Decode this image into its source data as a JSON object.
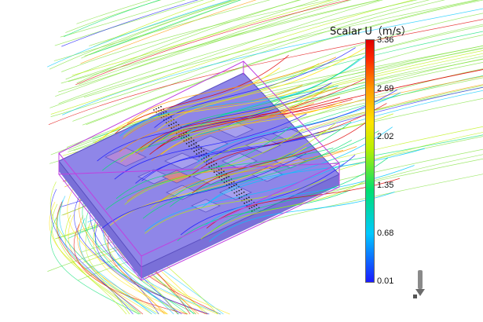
{
  "legend": {
    "title": "Scalar U（m/s）",
    "ticks": [
      "3.36",
      "2.69",
      "2.02",
      "1.35",
      "0.68",
      "0.01"
    ],
    "colors": [
      "#e00000",
      "#ff9a00",
      "#ffe400",
      "#b8f000",
      "#00e070",
      "#00c8ff",
      "#1a1aff"
    ]
  },
  "viewport": {
    "box_color": "#c040e0",
    "board_color": "#8f86e8",
    "icons": [
      "axis-triad-icon"
    ]
  }
}
